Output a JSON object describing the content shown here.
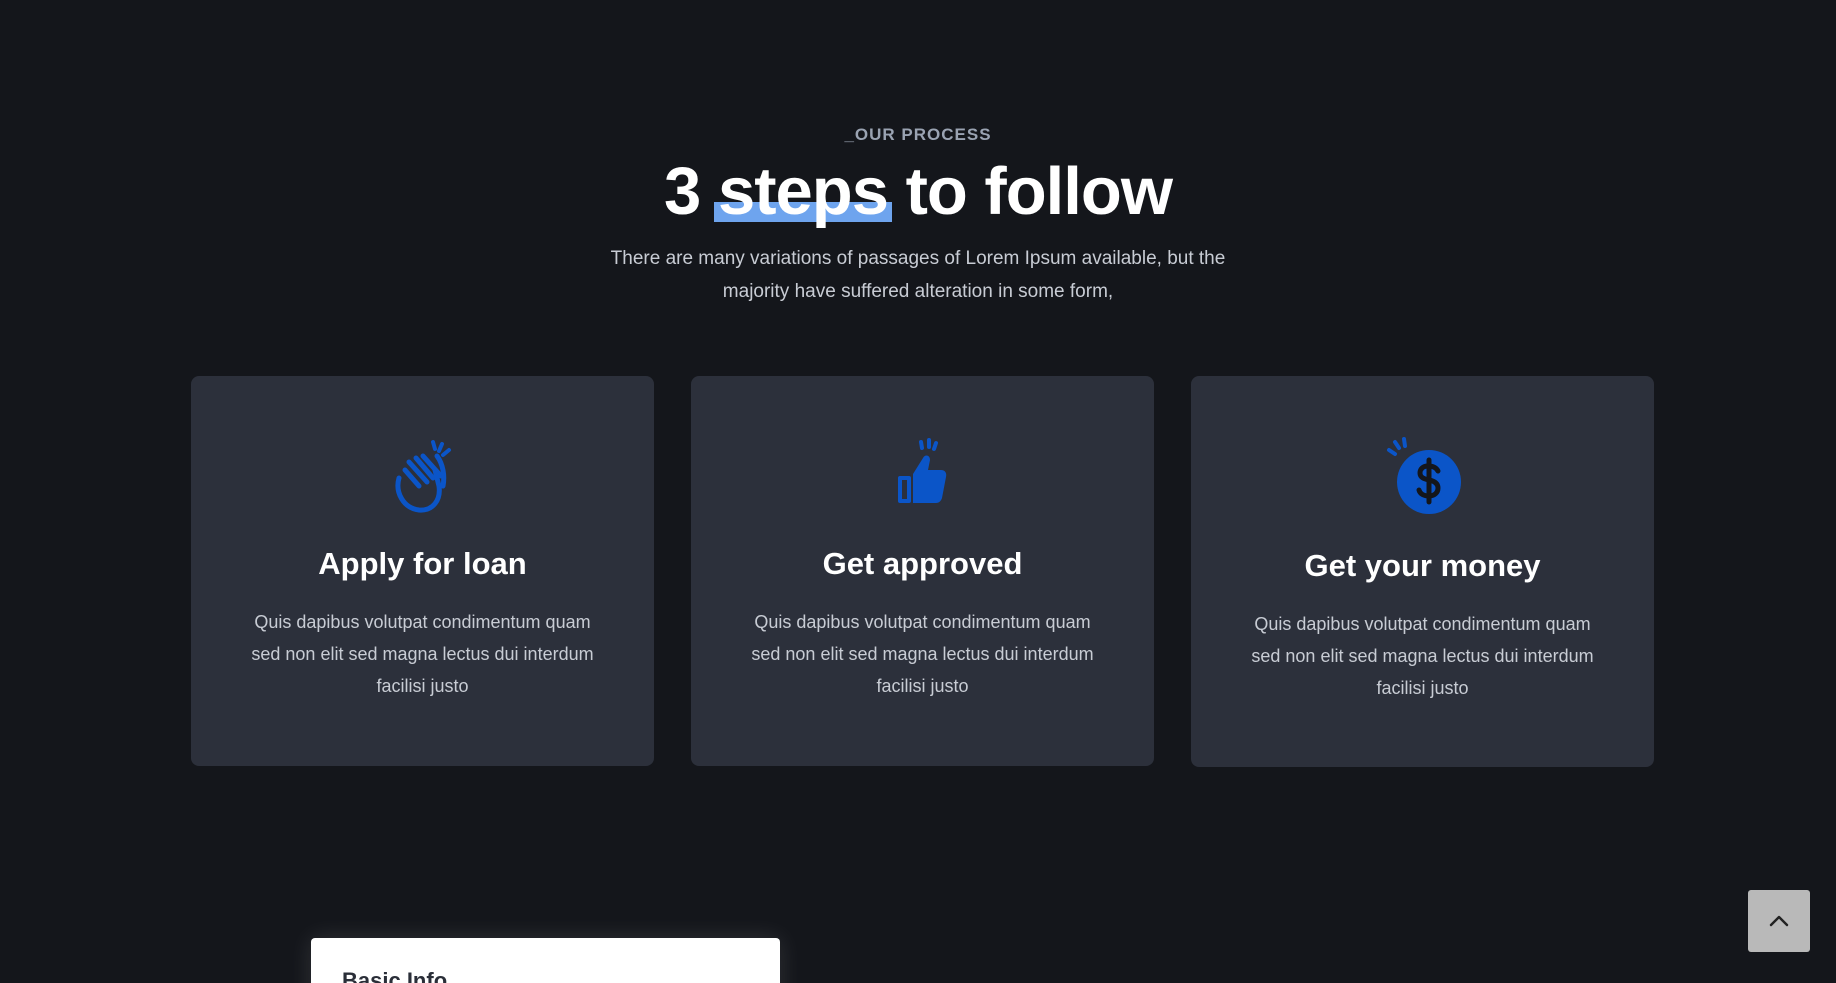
{
  "section": {
    "eyebrow": "_OUR PROCESS",
    "heading_prefix": "3 ",
    "heading_highlight": "steps",
    "heading_suffix": " to follow",
    "subtitle": "There are many variations of passages of Lorem Ipsum available, but the majority have suffered alteration in some form,"
  },
  "steps": [
    {
      "icon": "clapping-hands-icon",
      "title": "Apply for loan",
      "description": "Quis dapibus volutpat condimentum quam sed non elit sed magna lectus dui interdum facilisi justo"
    },
    {
      "icon": "thumbs-up-icon",
      "title": "Get approved",
      "description": "Quis dapibus volutpat condimentum quam sed non elit sed magna lectus dui interdum facilisi justo"
    },
    {
      "icon": "dollar-coin-icon",
      "title": "Get your money",
      "description": "Quis dapibus volutpat condimentum quam sed non elit sed magna lectus dui interdum facilisi justo"
    }
  ],
  "form": {
    "title": "Basic Info"
  },
  "scroll_top": {
    "icon": "chevron-up-icon"
  },
  "colors": {
    "background": "#14161b",
    "card": "#2c303b",
    "accent": "#0b55c8",
    "highlight": "#6ea4ee"
  }
}
